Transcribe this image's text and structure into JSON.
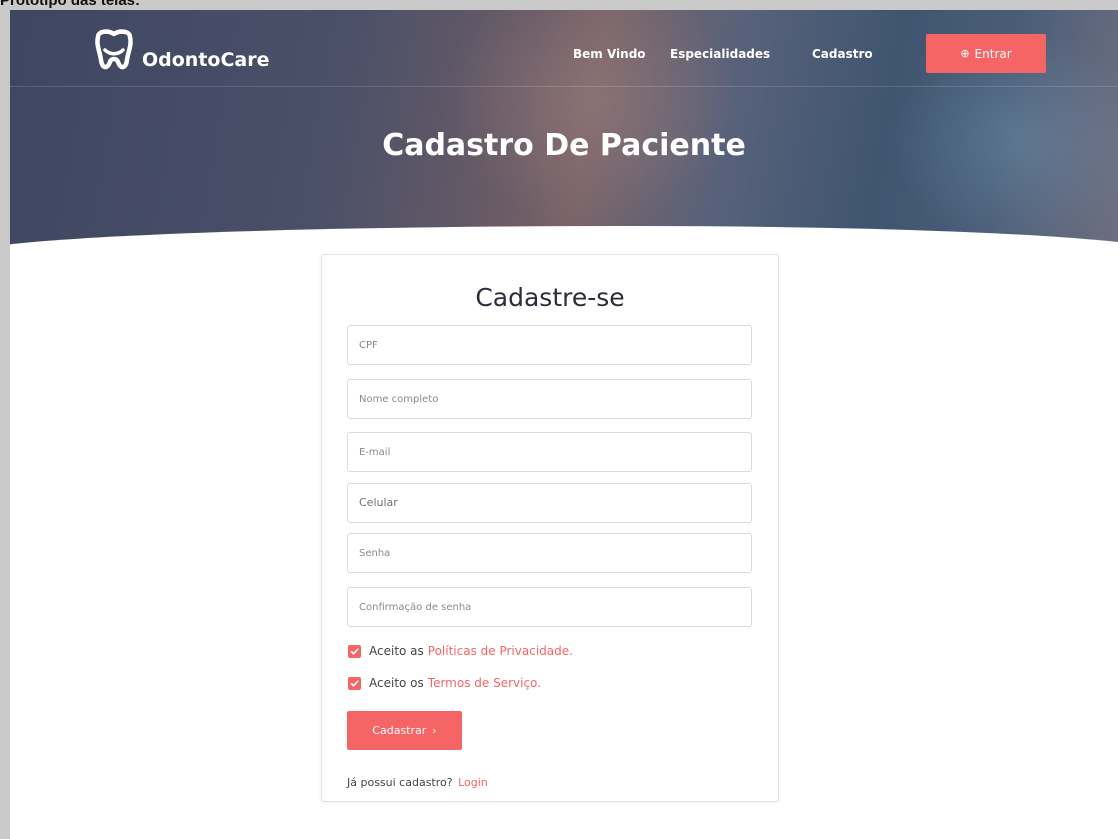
{
  "document": {
    "caption": "Protótipo das telas:"
  },
  "brand": {
    "name": "OdontoCare",
    "logo_icon": "tooth-icon"
  },
  "nav": {
    "items": [
      {
        "label": "Bem Vindo"
      },
      {
        "label": "Especialidades"
      },
      {
        "label": "Cadastro"
      }
    ],
    "login_button": {
      "icon": "login-circle-icon",
      "icon_glyph": "⊕",
      "label": "Entrar"
    }
  },
  "hero": {
    "title": "Cadastro De Paciente"
  },
  "form": {
    "title": "Cadastre-se",
    "fields": [
      {
        "placeholder": "CPF",
        "value": ""
      },
      {
        "placeholder": "Nome completo",
        "value": ""
      },
      {
        "placeholder": "E-mail",
        "value": ""
      },
      {
        "placeholder": "Celular",
        "value": ""
      },
      {
        "placeholder": "Senha",
        "value": ""
      },
      {
        "placeholder": "Confirmação de senha",
        "value": ""
      }
    ],
    "checkboxes": [
      {
        "text": "Aceito as",
        "link": "Políticas de Privacidade.",
        "checked": true
      },
      {
        "text": "Aceito os",
        "link": "Termos de Serviço.",
        "checked": true
      }
    ],
    "submit": {
      "label": "Cadastrar",
      "arrow": "›"
    },
    "footer": {
      "text": "Já possui cadastro?",
      "link": "Login"
    }
  },
  "colors": {
    "accent": "#f56565",
    "hero_dark": "#3e4661",
    "text_dark": "#2c2c3c"
  }
}
